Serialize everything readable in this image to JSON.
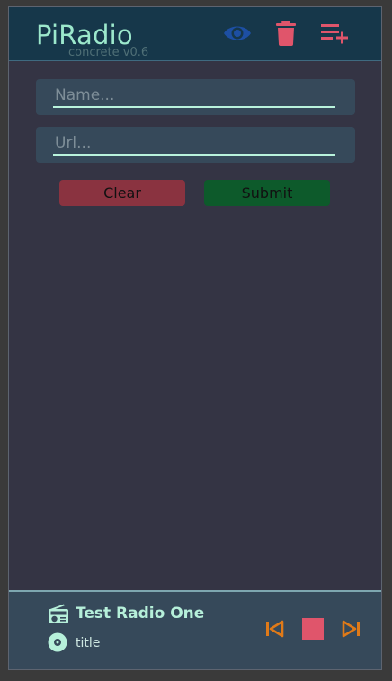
{
  "header": {
    "title": "PiRadio",
    "version": "concrete v0.6",
    "icons": [
      "eye-icon",
      "trash-icon",
      "playlist-add-icon"
    ]
  },
  "form": {
    "name_placeholder": "Name...",
    "url_placeholder": "Url...",
    "name_value": "",
    "url_value": "",
    "clear_label": "Clear",
    "submit_label": "Submit"
  },
  "player": {
    "station_name": "Test Radio One",
    "track_title": "title",
    "icons": [
      "radio-icon",
      "disc-icon",
      "skip-previous-icon",
      "stop-icon",
      "skip-next-icon"
    ]
  },
  "colors": {
    "accent": "#9ce8cc",
    "header_bg": "#16374a",
    "body_bg": "#343444",
    "panel_bg": "#36495a",
    "eye": "#1d4fa3",
    "trash": "#e0556b",
    "clear": "#8a3340",
    "submit": "#0d5a2b",
    "controls_orange": "#e07a18",
    "stop": "#e0556b"
  }
}
